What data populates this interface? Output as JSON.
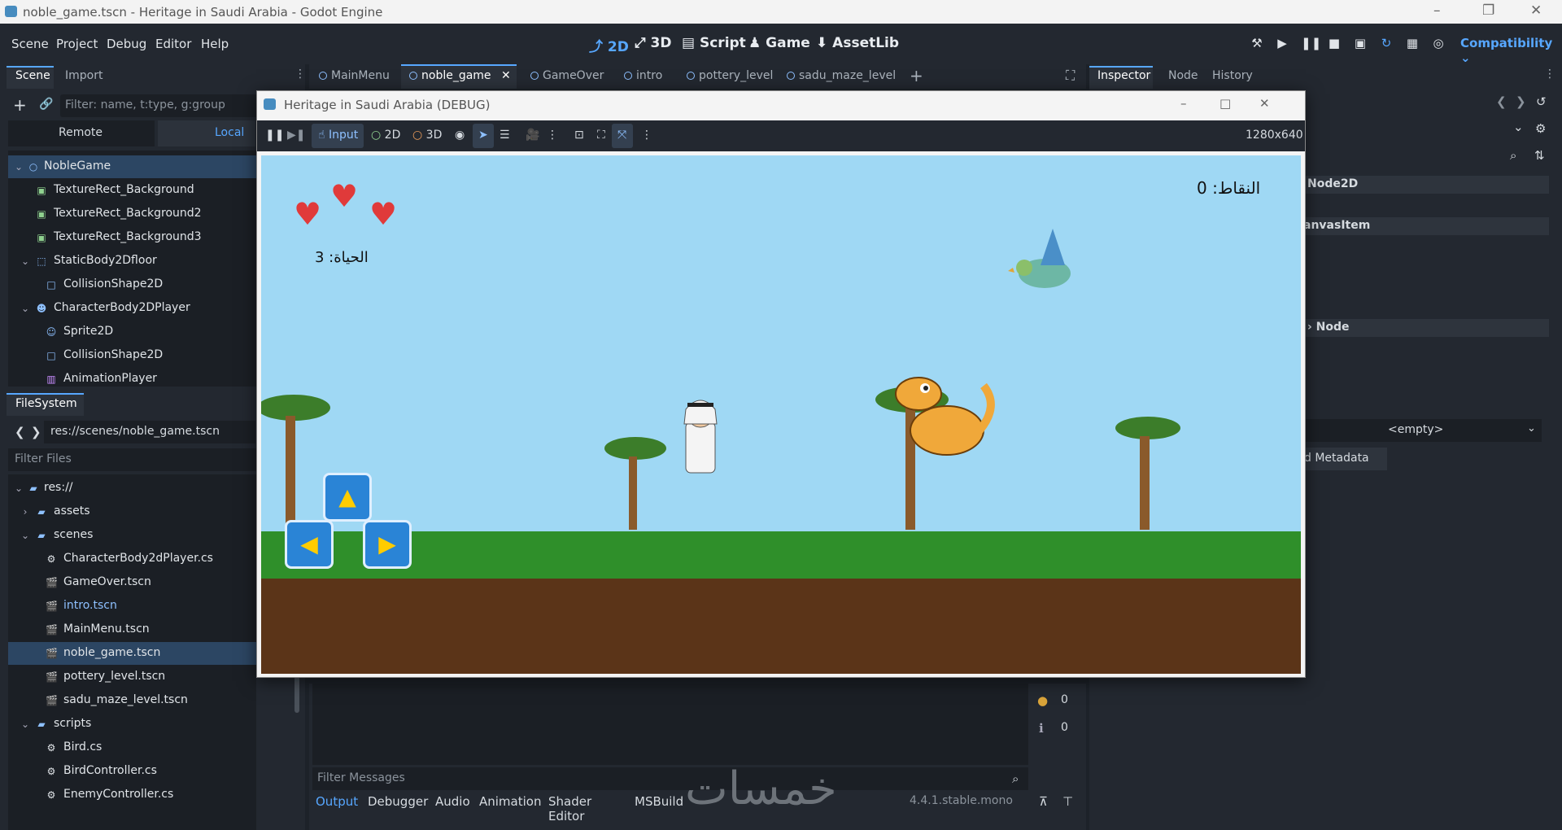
{
  "window": {
    "title": "noble_game.tscn - Heritage in Saudi Arabia - Godot Engine"
  },
  "menus": [
    "Scene",
    "Project",
    "Debug",
    "Editor",
    "Help"
  ],
  "workspaces": [
    {
      "label": "2D",
      "icon": "2d-icon"
    },
    {
      "label": "3D",
      "icon": "3d-icon"
    },
    {
      "label": "Script",
      "icon": "script-icon"
    },
    {
      "label": "Game",
      "icon": "game-icon"
    },
    {
      "label": "AssetLib",
      "icon": "assetlib-icon"
    }
  ],
  "renderer": "Compatibility",
  "scene_dock": {
    "tabs": [
      "Scene",
      "Import"
    ],
    "filter_placeholder": "Filter: name, t:type, g:group",
    "remote": "Remote",
    "local": "Local",
    "nodes": [
      {
        "label": "NobleGame",
        "icon": "node2d-icon"
      },
      {
        "label": "TextureRect_Background",
        "icon": "texturerect-icon"
      },
      {
        "label": "TextureRect_Background2",
        "icon": "texturerect-icon"
      },
      {
        "label": "TextureRect_Background3",
        "icon": "texturerect-icon"
      },
      {
        "label": "StaticBody2Dfloor",
        "icon": "staticbody-icon"
      },
      {
        "label": "CollisionShape2D",
        "icon": "collision-icon"
      },
      {
        "label": "CharacterBody2DPlayer",
        "icon": "characterbody-icon"
      },
      {
        "label": "Sprite2D",
        "icon": "sprite-icon"
      },
      {
        "label": "CollisionShape2D",
        "icon": "collision-icon"
      },
      {
        "label": "AnimationPlayer",
        "icon": "animationplayer-icon"
      }
    ]
  },
  "filesystem": {
    "tab": "FileSystem",
    "path": "res://scenes/noble_game.tscn",
    "filter_placeholder": "Filter Files",
    "items": [
      {
        "label": "res://",
        "icon": "folder-icon"
      },
      {
        "label": "assets",
        "icon": "folder-icon"
      },
      {
        "label": "scenes",
        "icon": "folder-icon"
      },
      {
        "label": "CharacterBody2dPlayer.cs",
        "icon": "csharp-icon"
      },
      {
        "label": "GameOver.tscn",
        "icon": "scene-icon"
      },
      {
        "label": "intro.tscn",
        "icon": "scene-icon"
      },
      {
        "label": "MainMenu.tscn",
        "icon": "scene-icon"
      },
      {
        "label": "noble_game.tscn",
        "icon": "scene-icon"
      },
      {
        "label": "pottery_level.tscn",
        "icon": "scene-icon"
      },
      {
        "label": "sadu_maze_level.tscn",
        "icon": "scene-icon"
      },
      {
        "label": "scripts",
        "icon": "folder-icon"
      },
      {
        "label": "Bird.cs",
        "icon": "csharp-icon"
      },
      {
        "label": "BirdController.cs",
        "icon": "csharp-icon"
      },
      {
        "label": "EnemyController.cs",
        "icon": "csharp-icon"
      }
    ]
  },
  "editor_tabs": [
    "MainMenu",
    "noble_game",
    "GameOver",
    "intro",
    "pottery_level",
    "sadu_maze_level"
  ],
  "inspector": {
    "tabs": [
      "Inspector",
      "Node",
      "History"
    ],
    "sections": [
      "Node2D",
      "anvasItem",
      "Node"
    ],
    "empty": "<empty>",
    "metadata": "d Metadata"
  },
  "game_window": {
    "title": "Heritage in Saudi Arabia (DEBUG)",
    "toolbar": {
      "input": "Input",
      "mode2d": "2D",
      "mode3d": "3D",
      "resolution": "1280x640"
    },
    "hud": {
      "score": "النقاط: 0",
      "lives": "الحياة: 3",
      "hearts": 3
    }
  },
  "bottom": {
    "filter_placeholder": "Filter Messages",
    "errors": "0",
    "warnings": "0",
    "tabs": [
      "Output",
      "Debugger",
      "Audio",
      "Animation",
      "Shader Editor",
      "MSBuild"
    ],
    "version": "4.4.1.stable.mono",
    "watermark": "خمسات"
  },
  "colors": {
    "accent": "#57a7ff",
    "selection": "#2c4663",
    "sky": "#9fd8f4"
  }
}
